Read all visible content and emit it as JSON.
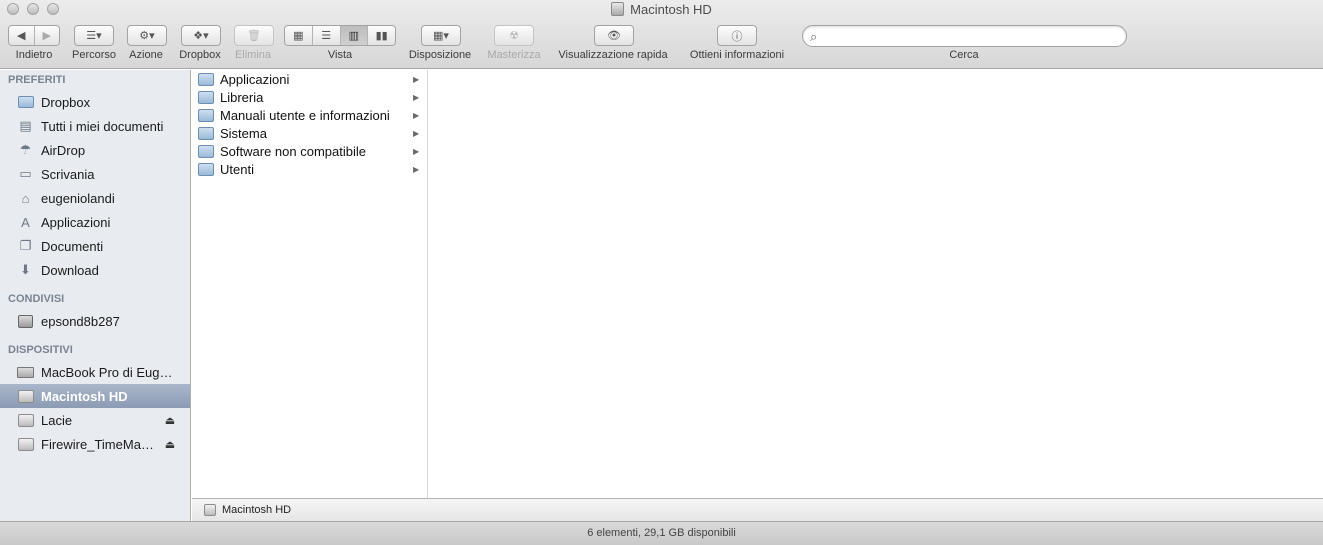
{
  "window": {
    "title": "Macintosh HD"
  },
  "toolbar": {
    "back_label": "Indietro",
    "path_label": "Percorso",
    "action_label": "Azione",
    "dropbox_label": "Dropbox",
    "delete_label": "Elimina",
    "view_label": "Vista",
    "arrange_label": "Disposizione",
    "burn_label": "Masterizza",
    "quicklook_label": "Visualizzazione rapida",
    "info_label": "Ottieni informazioni",
    "search_label": "Cerca",
    "search_value": "",
    "search_placeholder": ""
  },
  "sidebar": {
    "favorites_header": "PREFERITI",
    "favorites": [
      {
        "label": "Dropbox",
        "icon": "folder-icon"
      },
      {
        "label": "Tutti i miei documenti",
        "icon": "all-documents-icon"
      },
      {
        "label": "AirDrop",
        "icon": "airdrop-icon"
      },
      {
        "label": "Scrivania",
        "icon": "desktop-icon"
      },
      {
        "label": "eugeniolandi",
        "icon": "home-icon"
      },
      {
        "label": "Applicazioni",
        "icon": "applications-icon"
      },
      {
        "label": "Documenti",
        "icon": "documents-icon"
      },
      {
        "label": "Download",
        "icon": "download-icon"
      }
    ],
    "shared_header": "CONDIVISI",
    "shared": [
      {
        "label": "epsond8b287",
        "icon": "network-monitor-icon"
      }
    ],
    "devices_header": "DISPOSITIVI",
    "devices": [
      {
        "label": "MacBook Pro di Eug…",
        "icon": "laptop-icon"
      },
      {
        "label": "Macintosh HD",
        "icon": "drive-icon",
        "selected": true
      },
      {
        "label": "Lacie",
        "icon": "drive-icon",
        "eject": true
      },
      {
        "label": "Firewire_TimeMa…",
        "icon": "timemachine-drive-icon",
        "eject": true
      }
    ]
  },
  "column": {
    "items": [
      {
        "label": "Applicazioni"
      },
      {
        "label": "Libreria"
      },
      {
        "label": "Manuali utente e informazioni"
      },
      {
        "label": "Sistema"
      },
      {
        "label": "Software non compatibile"
      },
      {
        "label": "Utenti"
      }
    ]
  },
  "pathbar": {
    "label": "Macintosh HD"
  },
  "status": {
    "text": "6 elementi, 29,1 GB disponibili"
  },
  "colors": {
    "selection": "#9aa8be",
    "sidebar_bg": "#e8ecf1",
    "folder": "#9ab9d9"
  }
}
